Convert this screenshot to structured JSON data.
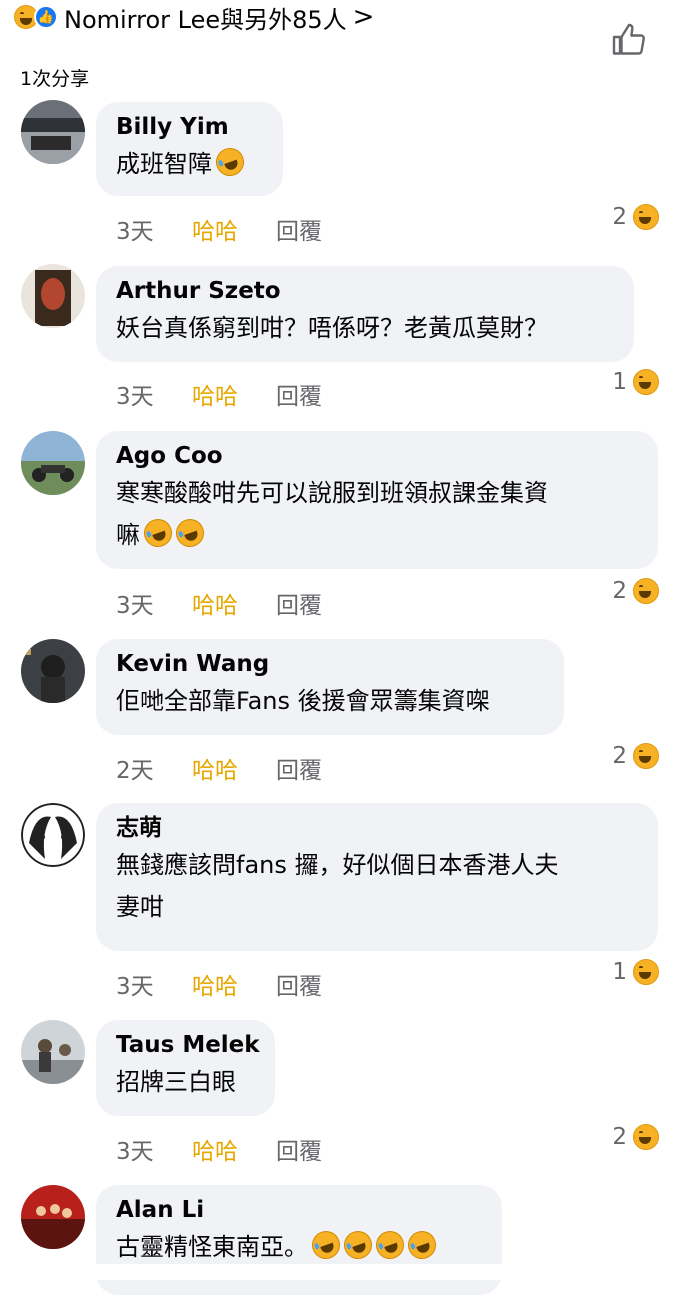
{
  "header": {
    "reactors": "Nomirror Lee與另外85人",
    "shares": "1次分享",
    "reaction_icons": [
      "haha-icon",
      "like-icon"
    ]
  },
  "labels": {
    "haha": "哈哈",
    "reply": "回覆"
  },
  "comments": [
    {
      "name": "Billy Yim",
      "lines": [
        "成班智障"
      ],
      "time": "3天",
      "count": "2",
      "emoji_count": 1
    },
    {
      "name": "Arthur Szeto",
      "lines": [
        "妖台真係窮到咁？唔係呀？老黃瓜莫財？"
      ],
      "time": "3天",
      "count": "1",
      "emoji_count": 0
    },
    {
      "name": "Ago Coo",
      "lines": [
        "寒寒酸酸咁先可以說服到班領叔課金集資",
        "嘛"
      ],
      "time": "3天",
      "count": "2",
      "emoji_count": 2
    },
    {
      "name": "Kevin Wang",
      "lines": [
        "佢哋全部靠Fans 後援會眾籌集資㗎"
      ],
      "time": "2天",
      "count": "2",
      "emoji_count": 0
    },
    {
      "name": "志萌",
      "lines": [
        "無錢應該問fans 攞，好似個日本香港人夫",
        "妻咁"
      ],
      "time": "3天",
      "count": "1",
      "emoji_count": 0
    },
    {
      "name": "Taus Melek",
      "lines": [
        "招牌三白眼"
      ],
      "time": "3天",
      "count": "2",
      "emoji_count": 0
    },
    {
      "name": "Alan Li",
      "lines": [
        "古靈精怪東南亞。"
      ],
      "time": "",
      "count": "",
      "emoji_count": 4
    }
  ],
  "colors": {
    "bubble": "#f0f2f5",
    "haha_label": "#e6a800",
    "meta": "#65676b",
    "like_blue": "#1877f2"
  }
}
